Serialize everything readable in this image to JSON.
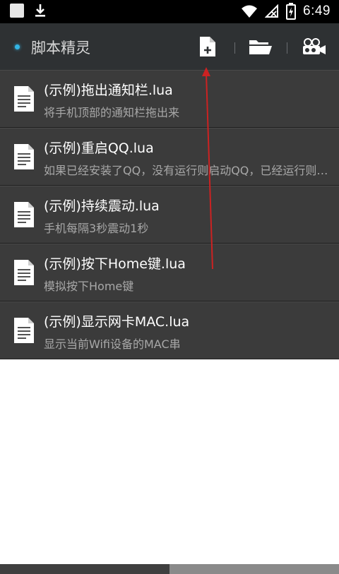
{
  "status_bar": {
    "time": "6:49",
    "icons": [
      "notification-square-icon",
      "download-icon",
      "wifi-icon",
      "no-signal-icon",
      "battery-charging-icon"
    ]
  },
  "toolbar": {
    "title": "脚本精灵",
    "buttons": [
      "new-file-icon",
      "folder-icon",
      "record-icon"
    ]
  },
  "scripts": [
    {
      "title": "(示例)拖出通知栏.lua",
      "desc": "将手机顶部的通知栏拖出来"
    },
    {
      "title": "(示例)重启QQ.lua",
      "desc": "如果已经安装了QQ，没有运行则启动QQ，已经运行则重启QQ"
    },
    {
      "title": "(示例)持续震动.lua",
      "desc": "手机每隔3秒震动1秒"
    },
    {
      "title": "(示例)按下Home键.lua",
      "desc": "模拟按下Home键"
    },
    {
      "title": "(示例)显示网卡MAC.lua",
      "desc": "显示当前Wifi设备的MAC串"
    }
  ],
  "colors": {
    "accent": "#33b5e5",
    "toolbar_bg": "#2e3133",
    "list_bg": "#3b3b3b",
    "annotation_arrow": "#cc2222"
  }
}
